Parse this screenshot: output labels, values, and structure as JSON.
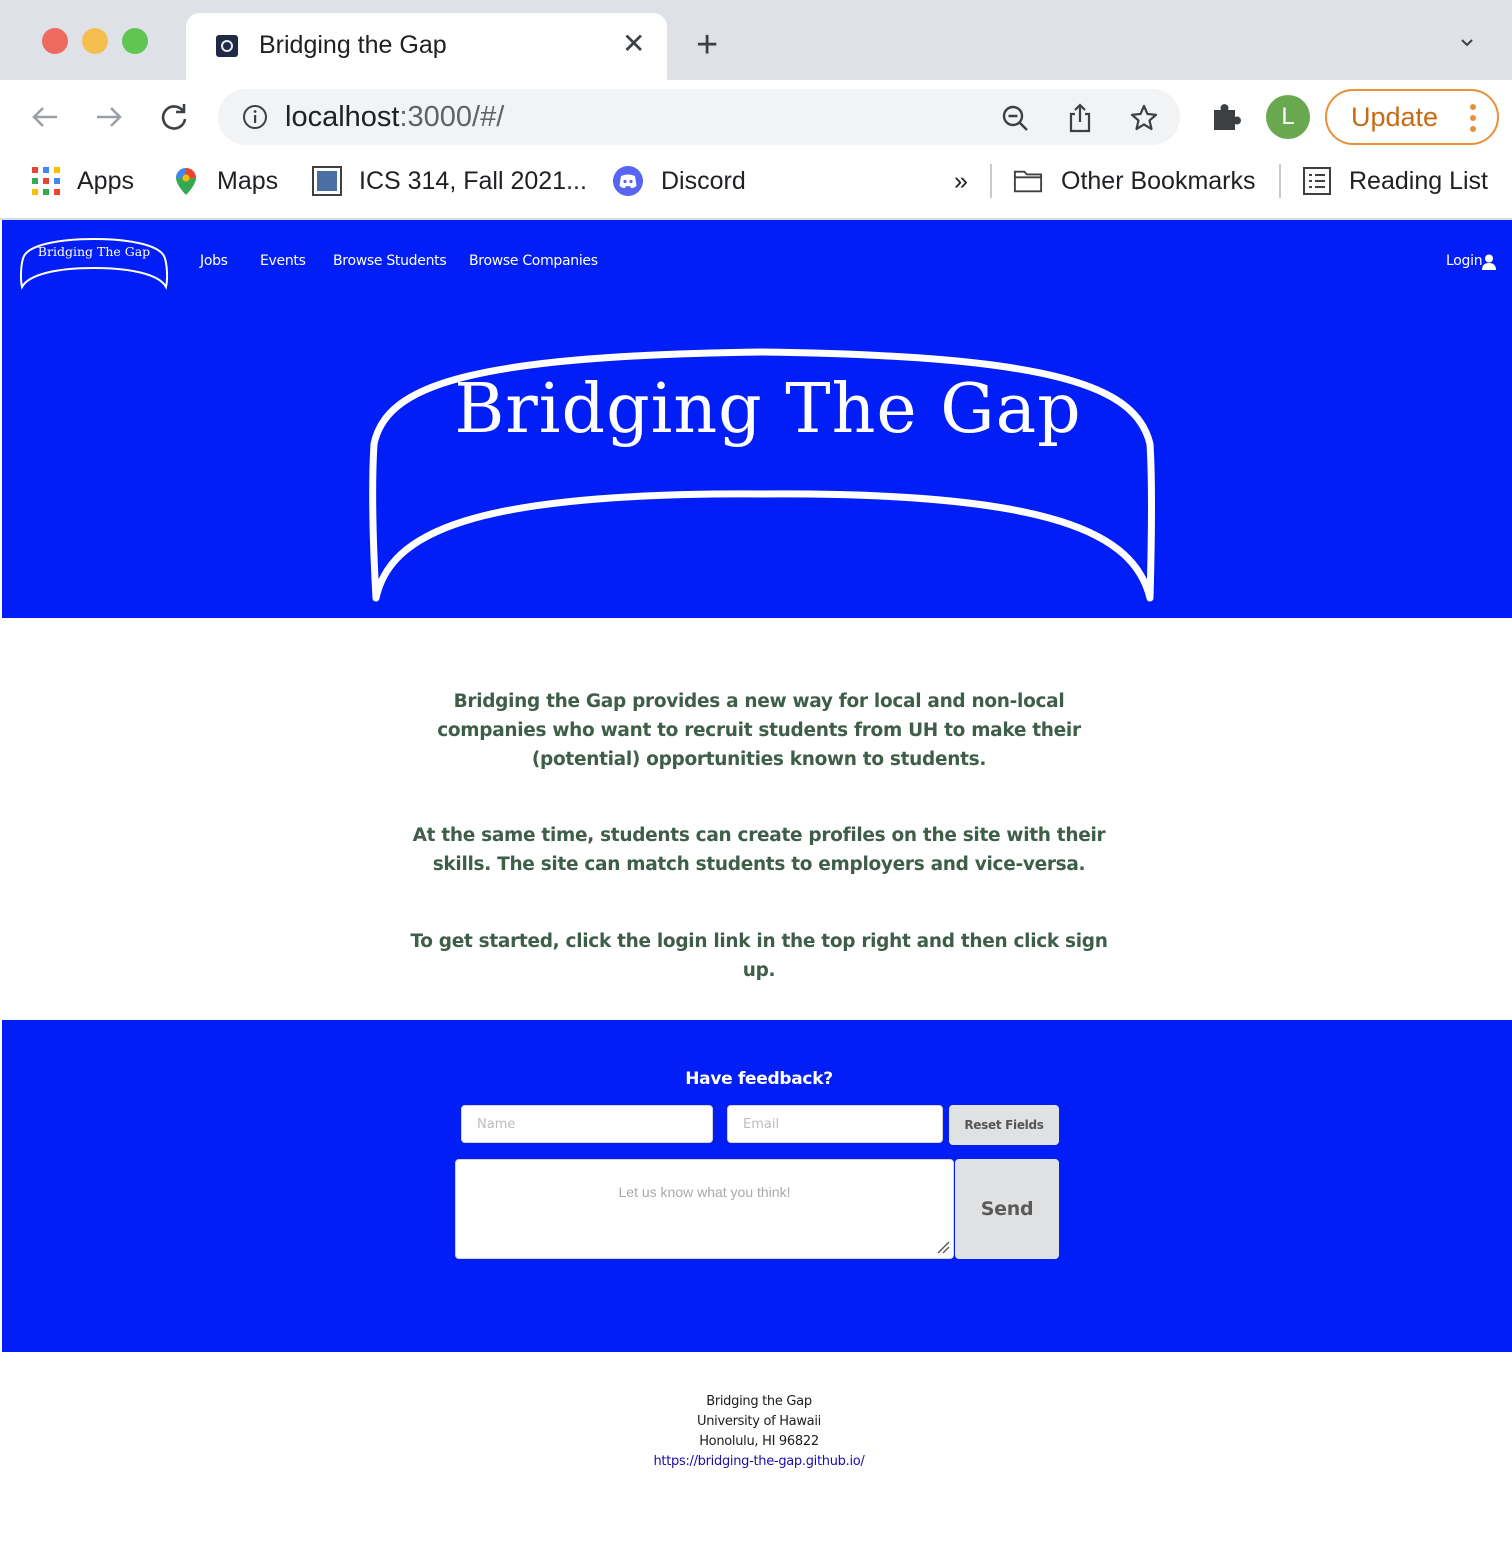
{
  "browser": {
    "tab": {
      "title": "Bridging the Gap"
    },
    "address_bar": {
      "host": "localhost",
      "path": ":3000/#/"
    },
    "profile_initial": "L",
    "update_label": "Update",
    "bookmarks": {
      "items": [
        {
          "label": "Apps",
          "icon": "apps-grid-icon"
        },
        {
          "label": "Maps",
          "icon": "maps-pin-icon"
        },
        {
          "label": "ICS 314, Fall 2021...",
          "icon": "square-favicon-icon"
        },
        {
          "label": "Discord",
          "icon": "discord-icon"
        }
      ],
      "overflow": "»",
      "other_bookmarks": "Other Bookmarks",
      "reading_list": "Reading List"
    }
  },
  "site": {
    "navbar": {
      "brand": "Bridging The Gap",
      "links": [
        "Jobs",
        "Events",
        "Browse Students",
        "Browse Companies"
      ],
      "login": "Login"
    },
    "hero": {
      "title": "Bridging The Gap"
    },
    "about": {
      "paragraphs": [
        "Bridging the Gap provides a new way for local and non-local companies who want to recruit students from UH to make their (potential) opportunities known to students.",
        "At the same time, students can create profiles on the site with their skills. The site can match students to employers and vice-versa.",
        "To get started, click the login link in the top right and then click sign up."
      ]
    },
    "feedback": {
      "heading": "Have feedback?",
      "name_placeholder": "Name",
      "email_placeholder": "Email",
      "reset_label": "Reset Fields",
      "message_placeholder": "Let us know what you think!",
      "send_label": "Send"
    },
    "footer": {
      "name": "Bridging the Gap",
      "university": "University of Hawaii",
      "address": "Honolulu, HI 96822",
      "url": "https://bridging-the-gap.github.io/"
    }
  },
  "colors": {
    "brand_blue": "#021ef6",
    "text_green": "#3f5e4a",
    "update_orange": "#e8913a"
  }
}
